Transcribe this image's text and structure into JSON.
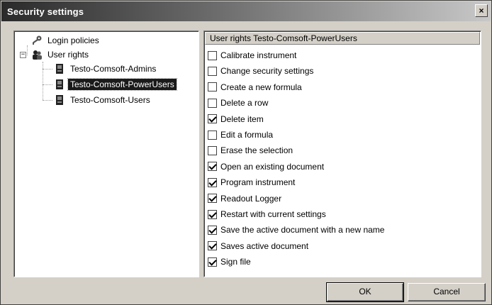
{
  "window": {
    "title": "Security settings",
    "close_glyph": "×"
  },
  "tree": {
    "login_policies": {
      "label": "Login policies",
      "icon": "key-icon"
    },
    "user_rights": {
      "label": "User rights",
      "icon": "users-group-icon",
      "expander": "−"
    },
    "groups": [
      {
        "label": "Testo-Comsoft-Admins",
        "icon": "user-icon",
        "selected": false
      },
      {
        "label": "Testo-Comsoft-PowerUsers",
        "icon": "user-icon",
        "selected": true
      },
      {
        "label": "Testo-Comsoft-Users",
        "icon": "user-icon",
        "selected": false
      }
    ]
  },
  "rights": {
    "header": "User rights Testo-Comsoft-PowerUsers",
    "items": [
      {
        "label": "Calibrate instrument",
        "checked": false
      },
      {
        "label": "Change security settings",
        "checked": false
      },
      {
        "label": "Create a new formula",
        "checked": false
      },
      {
        "label": "Delete a row",
        "checked": false
      },
      {
        "label": "Delete item",
        "checked": true
      },
      {
        "label": "Edit a formula",
        "checked": false
      },
      {
        "label": "Erase the selection",
        "checked": false
      },
      {
        "label": "Open an existing document",
        "checked": true
      },
      {
        "label": "Program instrument",
        "checked": true
      },
      {
        "label": "Readout Logger",
        "checked": true
      },
      {
        "label": "Restart with current settings",
        "checked": true
      },
      {
        "label": "Save the active document with a new name",
        "checked": true
      },
      {
        "label": "Saves active document",
        "checked": true
      },
      {
        "label": "Sign file",
        "checked": true
      }
    ]
  },
  "buttons": {
    "ok": "OK",
    "cancel": "Cancel"
  }
}
